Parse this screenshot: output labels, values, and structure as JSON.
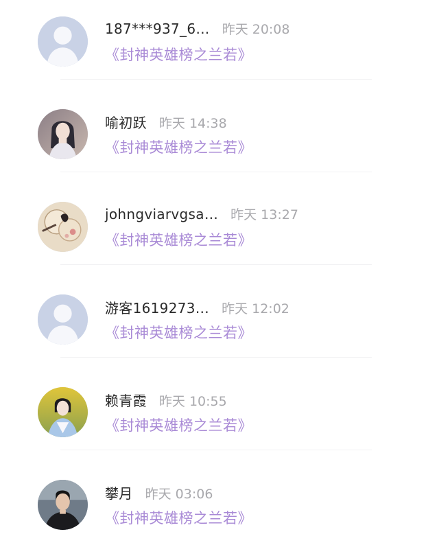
{
  "comments": [
    {
      "username": "187***937_6…",
      "time": "昨天 20:08",
      "book": "《封神英雄榜之兰若》",
      "avatar": "default-avatar-icon"
    },
    {
      "username": "喻初跃",
      "time": "昨天 14:38",
      "book": "《封神英雄榜之兰若》",
      "avatar": "user-photo-avatar"
    },
    {
      "username": "johngviarvgsa…",
      "time": "昨天 13:27",
      "book": "《封神英雄榜之兰若》",
      "avatar": "user-photo-avatar"
    },
    {
      "username": "游客1619273…",
      "time": "昨天 12:02",
      "book": "《封神英雄榜之兰若》",
      "avatar": "default-avatar-icon"
    },
    {
      "username": "赖青霞",
      "time": "昨天 10:55",
      "book": "《封神英雄榜之兰若》",
      "avatar": "user-photo-avatar"
    },
    {
      "username": "攀月",
      "time": "昨天 03:06",
      "book": "《封神英雄榜之兰若》",
      "avatar": "user-photo-avatar"
    }
  ],
  "colors": {
    "username": "#2b2b2b",
    "time": "#a9a9ad",
    "book_link": "#a98ad6",
    "default_avatar_bg": "#c9d2e6",
    "default_avatar_figure": "#ffffff"
  }
}
